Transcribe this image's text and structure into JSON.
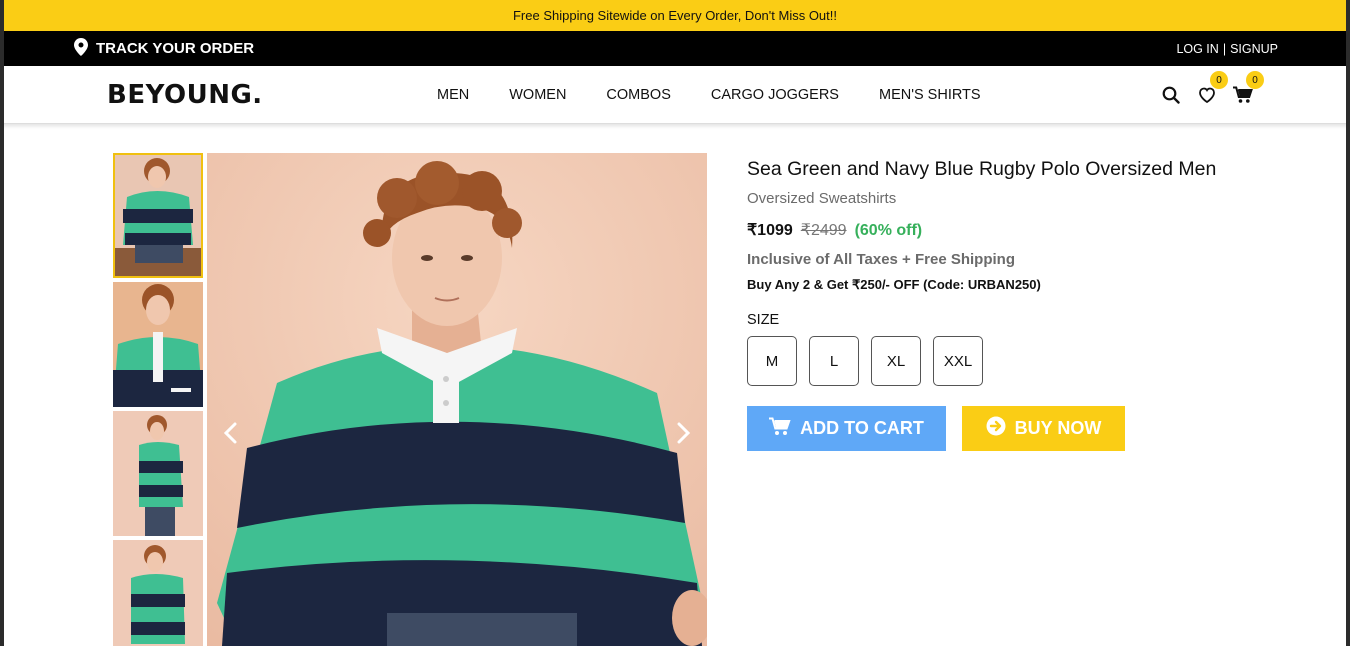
{
  "promo": {
    "text": "Free Shipping Sitewide on Every Order, Don't Miss Out!!"
  },
  "topbar": {
    "track_order": "TRACK YOUR ORDER",
    "login": "LOG IN",
    "separator": "|",
    "signup": "SIGNUP"
  },
  "nav": {
    "logo": "BEYOUNG.",
    "links": [
      "MEN",
      "WOMEN",
      "COMBOS",
      "CARGO JOGGERS",
      "MEN'S SHIRTS"
    ],
    "wishlist_count": "0",
    "cart_count": "0"
  },
  "product": {
    "title": "Sea Green and Navy Blue Rugby Polo Oversized Men",
    "category": "Oversized Sweatshirts",
    "price": "₹1099",
    "mrp": "₹2499",
    "discount": "(60% off)",
    "tax_note": "Inclusive of All Taxes + Free Shipping",
    "offer": "Buy Any 2 & Get ₹250/- OFF (Code: URBAN250)",
    "size_label": "SIZE",
    "sizes": [
      "M",
      "L",
      "XL",
      "XXL"
    ],
    "add_to_cart": "ADD TO CART",
    "buy_now": "BUY NOW"
  },
  "colors": {
    "accent_yellow": "#facd15",
    "cart_blue": "#5fa8f7",
    "discount_green": "#36b05b",
    "sea_green": "#3fbf92",
    "navy": "#1c2640"
  }
}
